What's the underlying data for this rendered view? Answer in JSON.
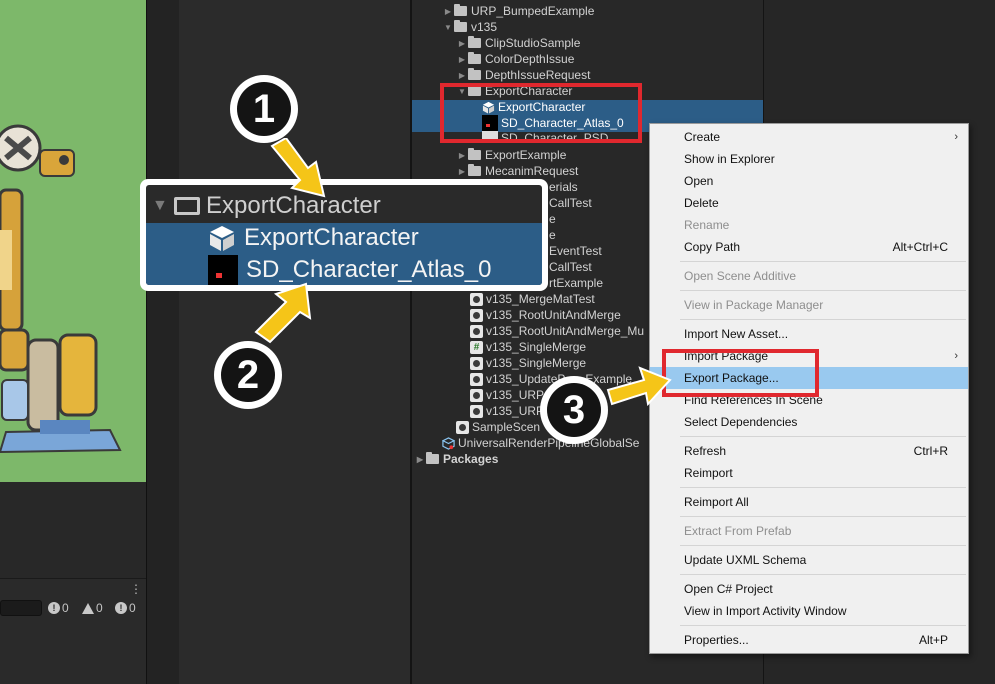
{
  "console": {
    "menu_glyph": "⋮",
    "counts": [
      {
        "icon": "info-icon",
        "value": "0"
      },
      {
        "icon": "warning-icon",
        "value": "0"
      },
      {
        "icon": "error-icon",
        "value": "0"
      }
    ]
  },
  "tree": {
    "items": [
      {
        "label": "URP_BumpedExample",
        "icon": "folder-icon",
        "expanded": false
      },
      {
        "label": "v135",
        "icon": "folder-open-icon",
        "expanded": true
      },
      {
        "label": "ClipStudioSample",
        "icon": "folder-icon",
        "expanded": false
      },
      {
        "label": "ColorDepthIssue",
        "icon": "folder-icon",
        "expanded": false
      },
      {
        "label": "DepthIssueRequest",
        "icon": "folder-icon",
        "expanded": false
      },
      {
        "label": "ExportCharacter",
        "icon": "folder-open-icon",
        "expanded": true
      },
      {
        "label": "ExportCharacter",
        "icon": "prefab-cube-icon",
        "selected": true
      },
      {
        "label": "SD_Character_Atlas_0",
        "icon": "texture-icon",
        "selected": true
      },
      {
        "label": "SD_Character_PSD",
        "icon": "psd-icon"
      },
      {
        "label": "ExportExample",
        "icon": "folder-icon",
        "expanded": false
      },
      {
        "label": "MecanimRequest",
        "icon": "folder-icon",
        "expanded": false
      },
      {
        "label": "erials",
        "icon": "folder-icon"
      },
      {
        "label": "CallTest",
        "icon": "folder-icon"
      },
      {
        "label": "e",
        "icon": "folder-icon"
      },
      {
        "label": "e",
        "icon": "folder-icon"
      },
      {
        "label": "EventTest",
        "icon": "folder-icon"
      },
      {
        "label": "CallTest",
        "icon": "folder-icon"
      },
      {
        "label": "rtExample",
        "icon": "folder-icon"
      },
      {
        "label": "v135_MergeMatTest",
        "icon": "scene-icon"
      },
      {
        "label": "v135_RootUnitAndMerge",
        "icon": "scene-icon"
      },
      {
        "label": "v135_RootUnitAndMerge_Mu",
        "icon": "scene-icon"
      },
      {
        "label": "v135_SingleMerge",
        "icon": "script-icon"
      },
      {
        "label": "v135_SingleMerge",
        "icon": "scene-icon"
      },
      {
        "label": "v135_UpdateP",
        "icon": "scene-icon"
      },
      {
        "label": "v135_URP",
        "icon": "scene-icon"
      },
      {
        "label": "v135_URP",
        "icon": "scene-icon"
      },
      {
        "label": "SampleScen",
        "icon": "scene-icon"
      },
      {
        "label": "UniversalRenderPipelineGlobalSe",
        "icon": "urp-asset-icon"
      },
      {
        "label": "Packages",
        "icon": "folder-icon",
        "expanded": false
      }
    ],
    "update_suffix": "Example"
  },
  "callout": {
    "folder_label": "ExportCharacter",
    "prefab_label": "ExportCharacter",
    "atlas_label": "SD_Character_Atlas_0"
  },
  "badges": [
    "1",
    "2",
    "3"
  ],
  "context_menu": {
    "items": [
      {
        "label": "Create",
        "shortcut": "",
        "submenu": true
      },
      {
        "label": "Show in Explorer",
        "shortcut": ""
      },
      {
        "label": "Open",
        "shortcut": ""
      },
      {
        "label": "Delete",
        "shortcut": ""
      },
      {
        "label": "Rename",
        "shortcut": "",
        "disabled": true
      },
      {
        "label": "Copy Path",
        "shortcut": "Alt+Ctrl+C"
      },
      {
        "label": "Open Scene Additive",
        "shortcut": "",
        "disabled": true
      },
      {
        "label": "View in Package Manager",
        "shortcut": "",
        "disabled": true
      },
      {
        "label": "Import New Asset...",
        "shortcut": ""
      },
      {
        "label": "Import Package",
        "shortcut": "",
        "submenu": true
      },
      {
        "label": "Export Package...",
        "shortcut": "",
        "highlighted": true
      },
      {
        "label": "Find References In Scene",
        "shortcut": ""
      },
      {
        "label": "Select Dependencies",
        "shortcut": ""
      },
      {
        "label": "Refresh",
        "shortcut": "Ctrl+R"
      },
      {
        "label": "Reimport",
        "shortcut": ""
      },
      {
        "label": "Reimport All",
        "shortcut": ""
      },
      {
        "label": "Extract From Prefab",
        "shortcut": "",
        "disabled": true
      },
      {
        "label": "Update UXML Schema",
        "shortcut": ""
      },
      {
        "label": "Open C# Project",
        "shortcut": ""
      },
      {
        "label": "View in Import Activity Window",
        "shortcut": ""
      },
      {
        "label": "Properties...",
        "shortcut": "Alt+P"
      }
    ],
    "submenu_glyph": "›"
  },
  "colors": {
    "selection": "#2c5d87",
    "menu_highlight": "#99c9ef",
    "annotation_red": "#e0282e",
    "arrow_yellow": "#f5c518",
    "scene_green": "#7db86a"
  }
}
